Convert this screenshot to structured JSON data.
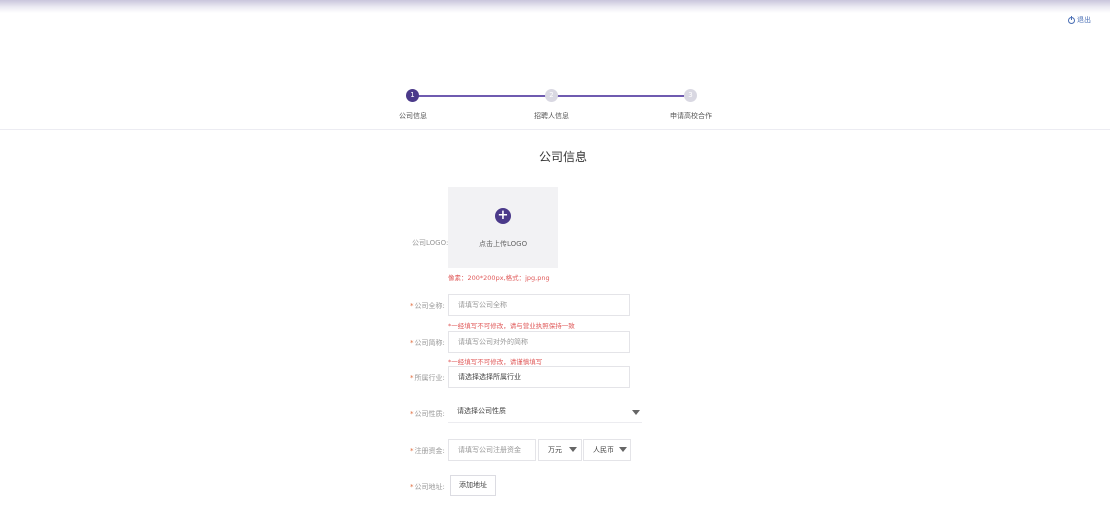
{
  "header": {
    "logout_label": "退出"
  },
  "steps": [
    {
      "number": "1",
      "label": "公司信息"
    },
    {
      "number": "2",
      "label": "招聘人信息"
    },
    {
      "number": "3",
      "label": "申请高校合作"
    }
  ],
  "section_title": "公司信息",
  "form": {
    "logo": {
      "label": "公司LOGO:",
      "upload_text": "点击上传LOGO",
      "hint": "像素：200*200px,格式：jpg,png"
    },
    "full_name": {
      "label": "公司全称:",
      "placeholder": "请填写公司全称",
      "hint": "*一经填写不可修改，请与营业执照保持一致"
    },
    "short_name": {
      "label": "公司简称:",
      "placeholder": "请填写公司对外的简称",
      "hint": "*一经填写不可修改，请谨慎填写"
    },
    "industry": {
      "label": "所属行业:",
      "value": "请选择选择所属行业"
    },
    "nature": {
      "label": "公司性质:",
      "value": "请选择公司性质"
    },
    "capital": {
      "label": "注册资金:",
      "placeholder": "请填写公司注册资金",
      "unit": "万元",
      "currency": "人民币"
    },
    "address": {
      "label": "公司地址:",
      "button": "添加地址"
    }
  }
}
